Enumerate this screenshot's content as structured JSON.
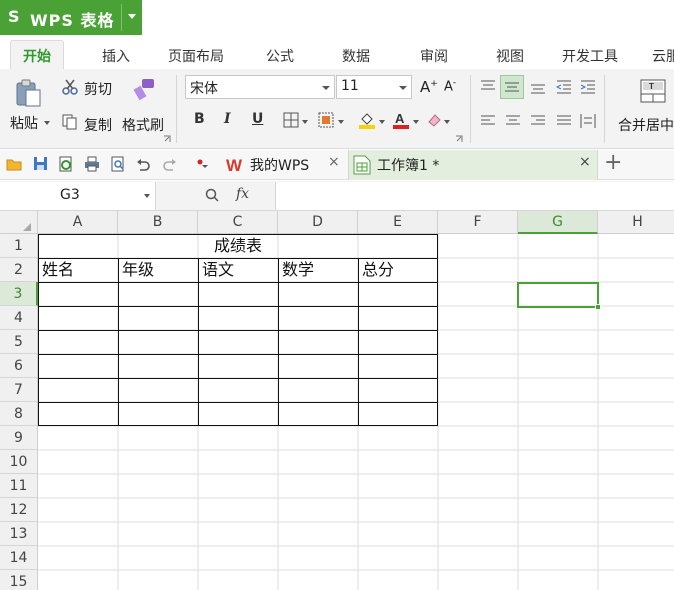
{
  "app": {
    "name": "WPS 表格",
    "logo_letter": "S"
  },
  "ribbon_tabs": [
    "开始",
    "插入",
    "页面布局",
    "公式",
    "数据",
    "审阅",
    "视图",
    "开发工具",
    "云服"
  ],
  "clipboard": {
    "paste": "粘贴",
    "cut": "剪切",
    "copy": "复制",
    "format_painter": "格式刷"
  },
  "font": {
    "family": "宋体",
    "size": "11",
    "bold": "B",
    "italic": "I",
    "underline": "U"
  },
  "merge_center": "合并居中",
  "doc_tabs": [
    {
      "title": "我的WPS"
    },
    {
      "title": "工作簿1 *"
    }
  ],
  "formula_bar": {
    "cell_ref": "G3",
    "fx": "fx",
    "formula": ""
  },
  "columns": [
    "A",
    "B",
    "C",
    "D",
    "E",
    "F",
    "G",
    "H"
  ],
  "rows": [
    "1",
    "2",
    "3",
    "4",
    "5",
    "6",
    "7",
    "8",
    "9",
    "10",
    "11",
    "12",
    "13",
    "14",
    "15"
  ],
  "selected_cell": "G3",
  "sheet": {
    "title": "成绩表",
    "headers": [
      "姓名",
      "年级",
      "语文",
      "数学",
      "总分"
    ]
  },
  "colors": {
    "accent": "#4aa236",
    "font_color": "#e02020",
    "highlight": "#f5d20a"
  }
}
